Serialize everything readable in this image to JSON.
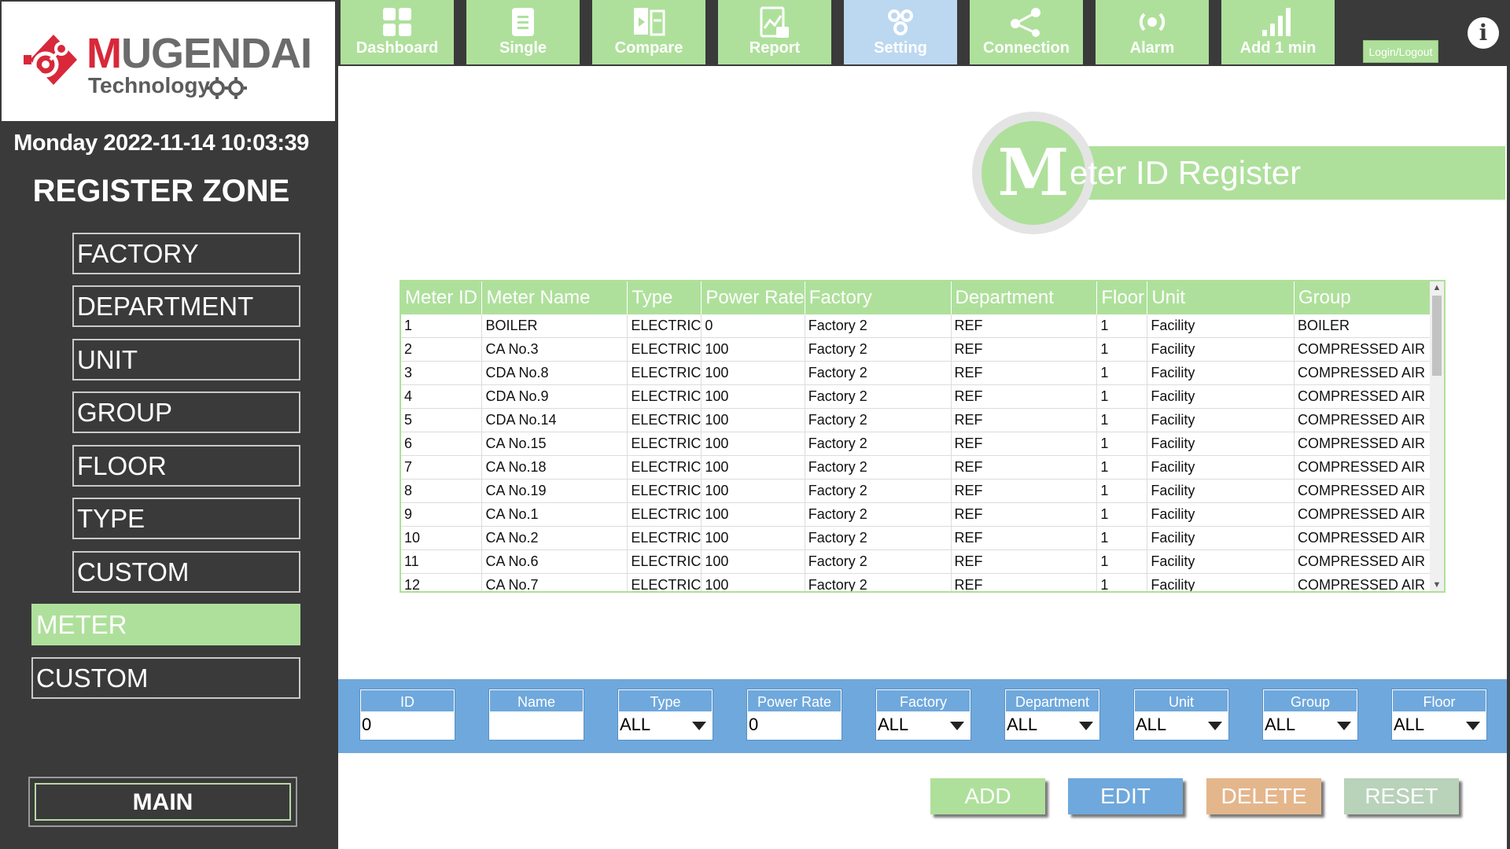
{
  "brand": {
    "name_first_letter": "M",
    "name_rest": "UGENDAI",
    "sub": "Technology",
    "accent_red": "#d8283a"
  },
  "sidebar": {
    "datetime": "Monday 2022-11-14 10:03:39",
    "zone_title": "REGISTER ZONE",
    "items": [
      {
        "label": "FACTORY",
        "active": false
      },
      {
        "label": "DEPARTMENT",
        "active": false
      },
      {
        "label": "UNIT",
        "active": false
      },
      {
        "label": "GROUP",
        "active": false
      },
      {
        "label": "FLOOR",
        "active": false
      },
      {
        "label": "TYPE",
        "active": false
      },
      {
        "label": "CUSTOM",
        "active": false
      },
      {
        "label": "METER",
        "active": true
      },
      {
        "label": "CUSTOM",
        "active": false
      }
    ],
    "main_button": "MAIN"
  },
  "nav": {
    "tiles": [
      {
        "label": "Dashboard",
        "icon": "dashboard-icon",
        "active": false
      },
      {
        "label": "Single",
        "icon": "single-doc-icon",
        "active": false
      },
      {
        "label": "Compare",
        "icon": "compare-icon",
        "active": false
      },
      {
        "label": "Report",
        "icon": "report-icon",
        "active": false
      },
      {
        "label": "Setting",
        "icon": "gears-icon",
        "active": true
      },
      {
        "label": "Connection",
        "icon": "share-icon",
        "active": false
      },
      {
        "label": "Alarm",
        "icon": "broadcast-icon",
        "active": false
      },
      {
        "label": "Add 1 min",
        "icon": "signal-bars-icon",
        "active": false
      }
    ],
    "login_label": "Login/Logout",
    "info_icon": "info-icon"
  },
  "page": {
    "title_initial": "M",
    "title_rest": "eter  ID Register"
  },
  "table": {
    "columns": [
      "Meter ID",
      "Meter Name",
      "Type",
      "Power Rate",
      "Factory",
      "Department",
      "Floor",
      "Unit",
      "Group"
    ],
    "rows": [
      [
        "1",
        "BOILER",
        "ELECTRIC",
        "0",
        "Factory 2",
        "REF",
        "1",
        "Facility",
        "BOILER"
      ],
      [
        "2",
        "CA No.3",
        "ELECTRIC",
        "100",
        "Factory 2",
        "REF",
        "1",
        "Facility",
        "COMPRESSED AIR"
      ],
      [
        "3",
        "CDA No.8",
        "ELECTRIC",
        "100",
        "Factory 2",
        "REF",
        "1",
        "Facility",
        "COMPRESSED AIR"
      ],
      [
        "4",
        "CDA No.9",
        "ELECTRIC",
        "100",
        "Factory 2",
        "REF",
        "1",
        "Facility",
        "COMPRESSED AIR"
      ],
      [
        "5",
        "CDA No.14",
        "ELECTRIC",
        "100",
        "Factory 2",
        "REF",
        "1",
        "Facility",
        "COMPRESSED AIR"
      ],
      [
        "6",
        "CA No.15",
        "ELECTRIC",
        "100",
        "Factory 2",
        "REF",
        "1",
        "Facility",
        "COMPRESSED AIR"
      ],
      [
        "7",
        "CA No.18",
        "ELECTRIC",
        "100",
        "Factory 2",
        "REF",
        "1",
        "Facility",
        "COMPRESSED AIR"
      ],
      [
        "8",
        "CA No.19",
        "ELECTRIC",
        "100",
        "Factory 2",
        "REF",
        "1",
        "Facility",
        "COMPRESSED AIR"
      ],
      [
        "9",
        "CA No.1",
        "ELECTRIC",
        "100",
        "Factory 2",
        "REF",
        "1",
        "Facility",
        "COMPRESSED AIR"
      ],
      [
        "10",
        "CA No.2",
        "ELECTRIC",
        "100",
        "Factory 2",
        "REF",
        "1",
        "Facility",
        "COMPRESSED AIR"
      ],
      [
        "11",
        "CA No.6",
        "ELECTRIC",
        "100",
        "Factory 2",
        "REF",
        "1",
        "Facility",
        "COMPRESSED AIR"
      ],
      [
        "12",
        "CA No.7",
        "ELECTRIC",
        "100",
        "Factory 2",
        "REF",
        "1",
        "Facility",
        "COMPRESSED AIR"
      ]
    ]
  },
  "filters": [
    {
      "label": "ID",
      "value": "0",
      "dropdown": false
    },
    {
      "label": "Name",
      "value": "",
      "dropdown": false
    },
    {
      "label": "Type",
      "value": "ALL",
      "dropdown": true
    },
    {
      "label": "Power Rate",
      "value": "0",
      "dropdown": false
    },
    {
      "label": "Factory",
      "value": "ALL",
      "dropdown": true
    },
    {
      "label": "Department",
      "value": "ALL",
      "dropdown": true
    },
    {
      "label": "Unit",
      "value": "ALL",
      "dropdown": true
    },
    {
      "label": "Group",
      "value": "ALL",
      "dropdown": true
    },
    {
      "label": "Floor",
      "value": "ALL",
      "dropdown": true
    }
  ],
  "actions": [
    {
      "label": "ADD",
      "color": "#aee09b"
    },
    {
      "label": "EDIT",
      "color": "#6fa8dc"
    },
    {
      "label": "DELETE",
      "color": "#e4b68c"
    },
    {
      "label": "RESET",
      "color": "#b9d2ba"
    }
  ],
  "colors": {
    "accent_green": "#aee09b",
    "accent_blue": "#6fa8dc",
    "dark_bg": "#3a3a3a"
  }
}
